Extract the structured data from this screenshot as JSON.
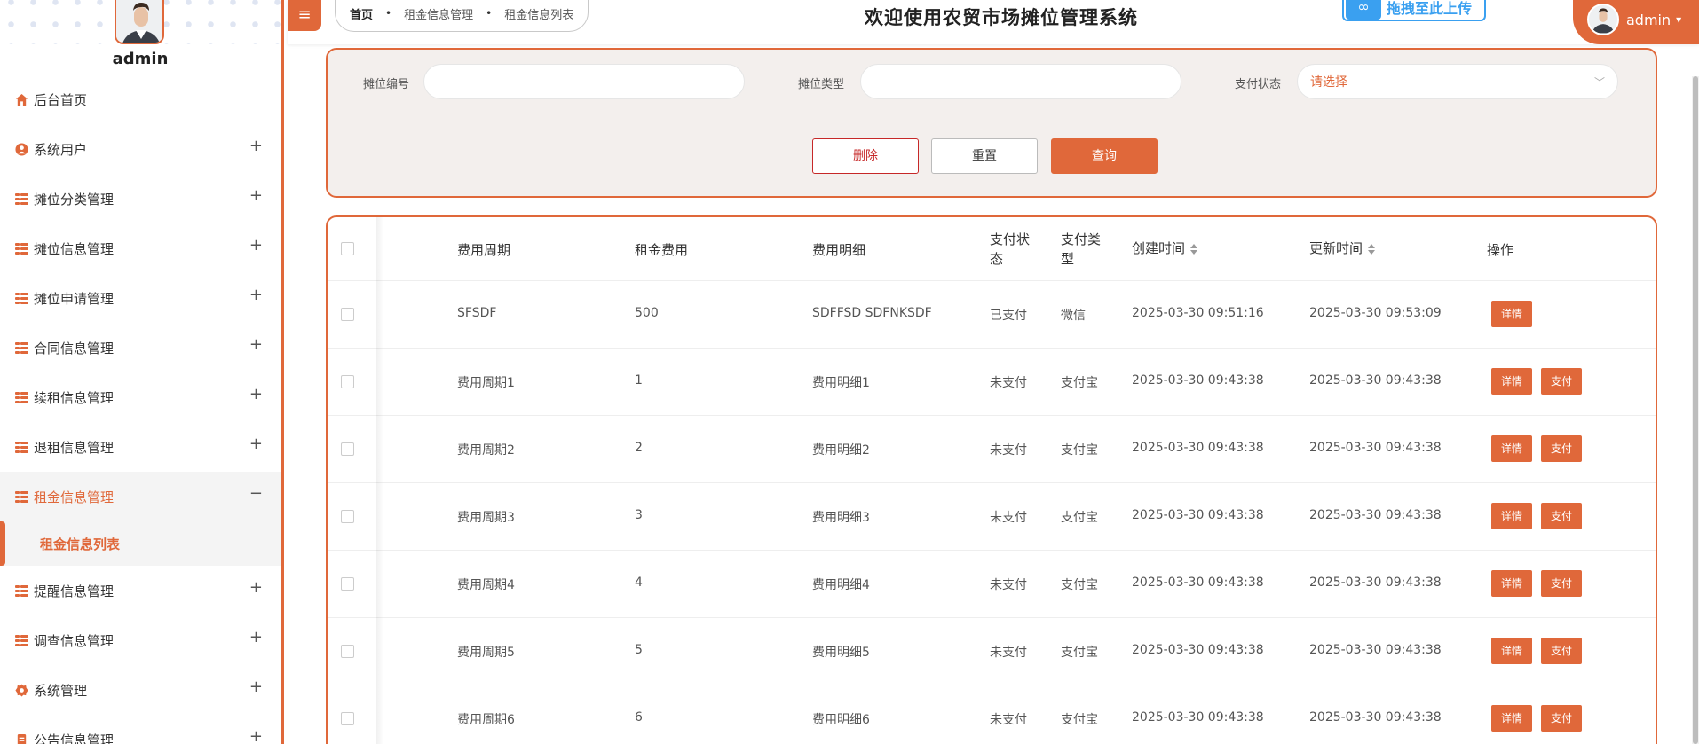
{
  "sidebar": {
    "admin_name": "admin",
    "menu": [
      {
        "label": "后台首页",
        "icon": "home-icon",
        "expand": ""
      },
      {
        "label": "系统用户",
        "icon": "user-icon",
        "expand": "+"
      },
      {
        "label": "摊位分类管理",
        "icon": "grid-icon",
        "expand": "+"
      },
      {
        "label": "摊位信息管理",
        "icon": "grid-icon",
        "expand": "+"
      },
      {
        "label": "摊位申请管理",
        "icon": "grid-icon",
        "expand": "+"
      },
      {
        "label": "合同信息管理",
        "icon": "grid-icon",
        "expand": "+"
      },
      {
        "label": "续租信息管理",
        "icon": "grid-icon",
        "expand": "+"
      },
      {
        "label": "退租信息管理",
        "icon": "grid-icon",
        "expand": "+"
      },
      {
        "label": "租金信息管理",
        "icon": "grid-icon",
        "expand": "−"
      },
      {
        "label": "提醒信息管理",
        "icon": "grid-icon",
        "expand": "+"
      },
      {
        "label": "调查信息管理",
        "icon": "grid-icon",
        "expand": "+"
      },
      {
        "label": "系统管理",
        "icon": "gear-icon",
        "expand": "+"
      },
      {
        "label": "公告信息管理",
        "icon": "notice-icon",
        "expand": "+"
      }
    ],
    "active_sub": "租金信息列表"
  },
  "header": {
    "menu_toggle": "≡",
    "breadcrumb": [
      "首页",
      "租金信息管理",
      "租金信息列表"
    ],
    "breadcrumb_sep": "•",
    "title": "欢迎使用农贸市场摊位管理系统",
    "upload_badge": "拖拽至此上传",
    "user": "admin",
    "user_caret": "▾"
  },
  "search": {
    "stall_no_label": "摊位编号",
    "stall_no_value": "",
    "stall_type_label": "摊位类型",
    "stall_type_value": "",
    "pay_status_label": "支付状态",
    "pay_status_placeholder": "请选择",
    "delete_label": "删除",
    "reset_label": "重置",
    "query_label": "查询"
  },
  "table": {
    "columns": [
      "费用周期",
      "租金费用",
      "费用明细",
      "支付状\n态",
      "支付类\n型",
      "创建时间",
      "更新时间",
      "操作"
    ],
    "detail_label": "详情",
    "pay_label": "支付",
    "rows": [
      {
        "period": "SFSDF",
        "fee": "500",
        "detail": "SDFFSD SDFNKSDF",
        "status": "已支付",
        "type": "微信",
        "created": "2025-03-30 09:51:16",
        "updated": "2025-03-30 09:53:09",
        "can_pay": false
      },
      {
        "period": "费用周期1",
        "fee": "1",
        "detail": "费用明细1",
        "status": "未支付",
        "type": "支付宝",
        "created": "2025-03-30 09:43:38",
        "updated": "2025-03-30 09:43:38",
        "can_pay": true
      },
      {
        "period": "费用周期2",
        "fee": "2",
        "detail": "费用明细2",
        "status": "未支付",
        "type": "支付宝",
        "created": "2025-03-30 09:43:38",
        "updated": "2025-03-30 09:43:38",
        "can_pay": true
      },
      {
        "period": "费用周期3",
        "fee": "3",
        "detail": "费用明细3",
        "status": "未支付",
        "type": "支付宝",
        "created": "2025-03-30 09:43:38",
        "updated": "2025-03-30 09:43:38",
        "can_pay": true
      },
      {
        "period": "费用周期4",
        "fee": "4",
        "detail": "费用明细4",
        "status": "未支付",
        "type": "支付宝",
        "created": "2025-03-30 09:43:38",
        "updated": "2025-03-30 09:43:38",
        "can_pay": true
      },
      {
        "period": "费用周期5",
        "fee": "5",
        "detail": "费用明细5",
        "status": "未支付",
        "type": "支付宝",
        "created": "2025-03-30 09:43:38",
        "updated": "2025-03-30 09:43:38",
        "can_pay": true
      },
      {
        "period": "费用周期6",
        "fee": "6",
        "detail": "费用明细6",
        "status": "未支付",
        "type": "支付宝",
        "created": "2025-03-30 09:43:38",
        "updated": "2025-03-30 09:43:38",
        "can_pay": true
      }
    ]
  },
  "colors": {
    "accent": "#e0683a",
    "danger": "#c62828",
    "panel_bg": "#f3efed",
    "badge_blue": "#3aa0f0"
  }
}
